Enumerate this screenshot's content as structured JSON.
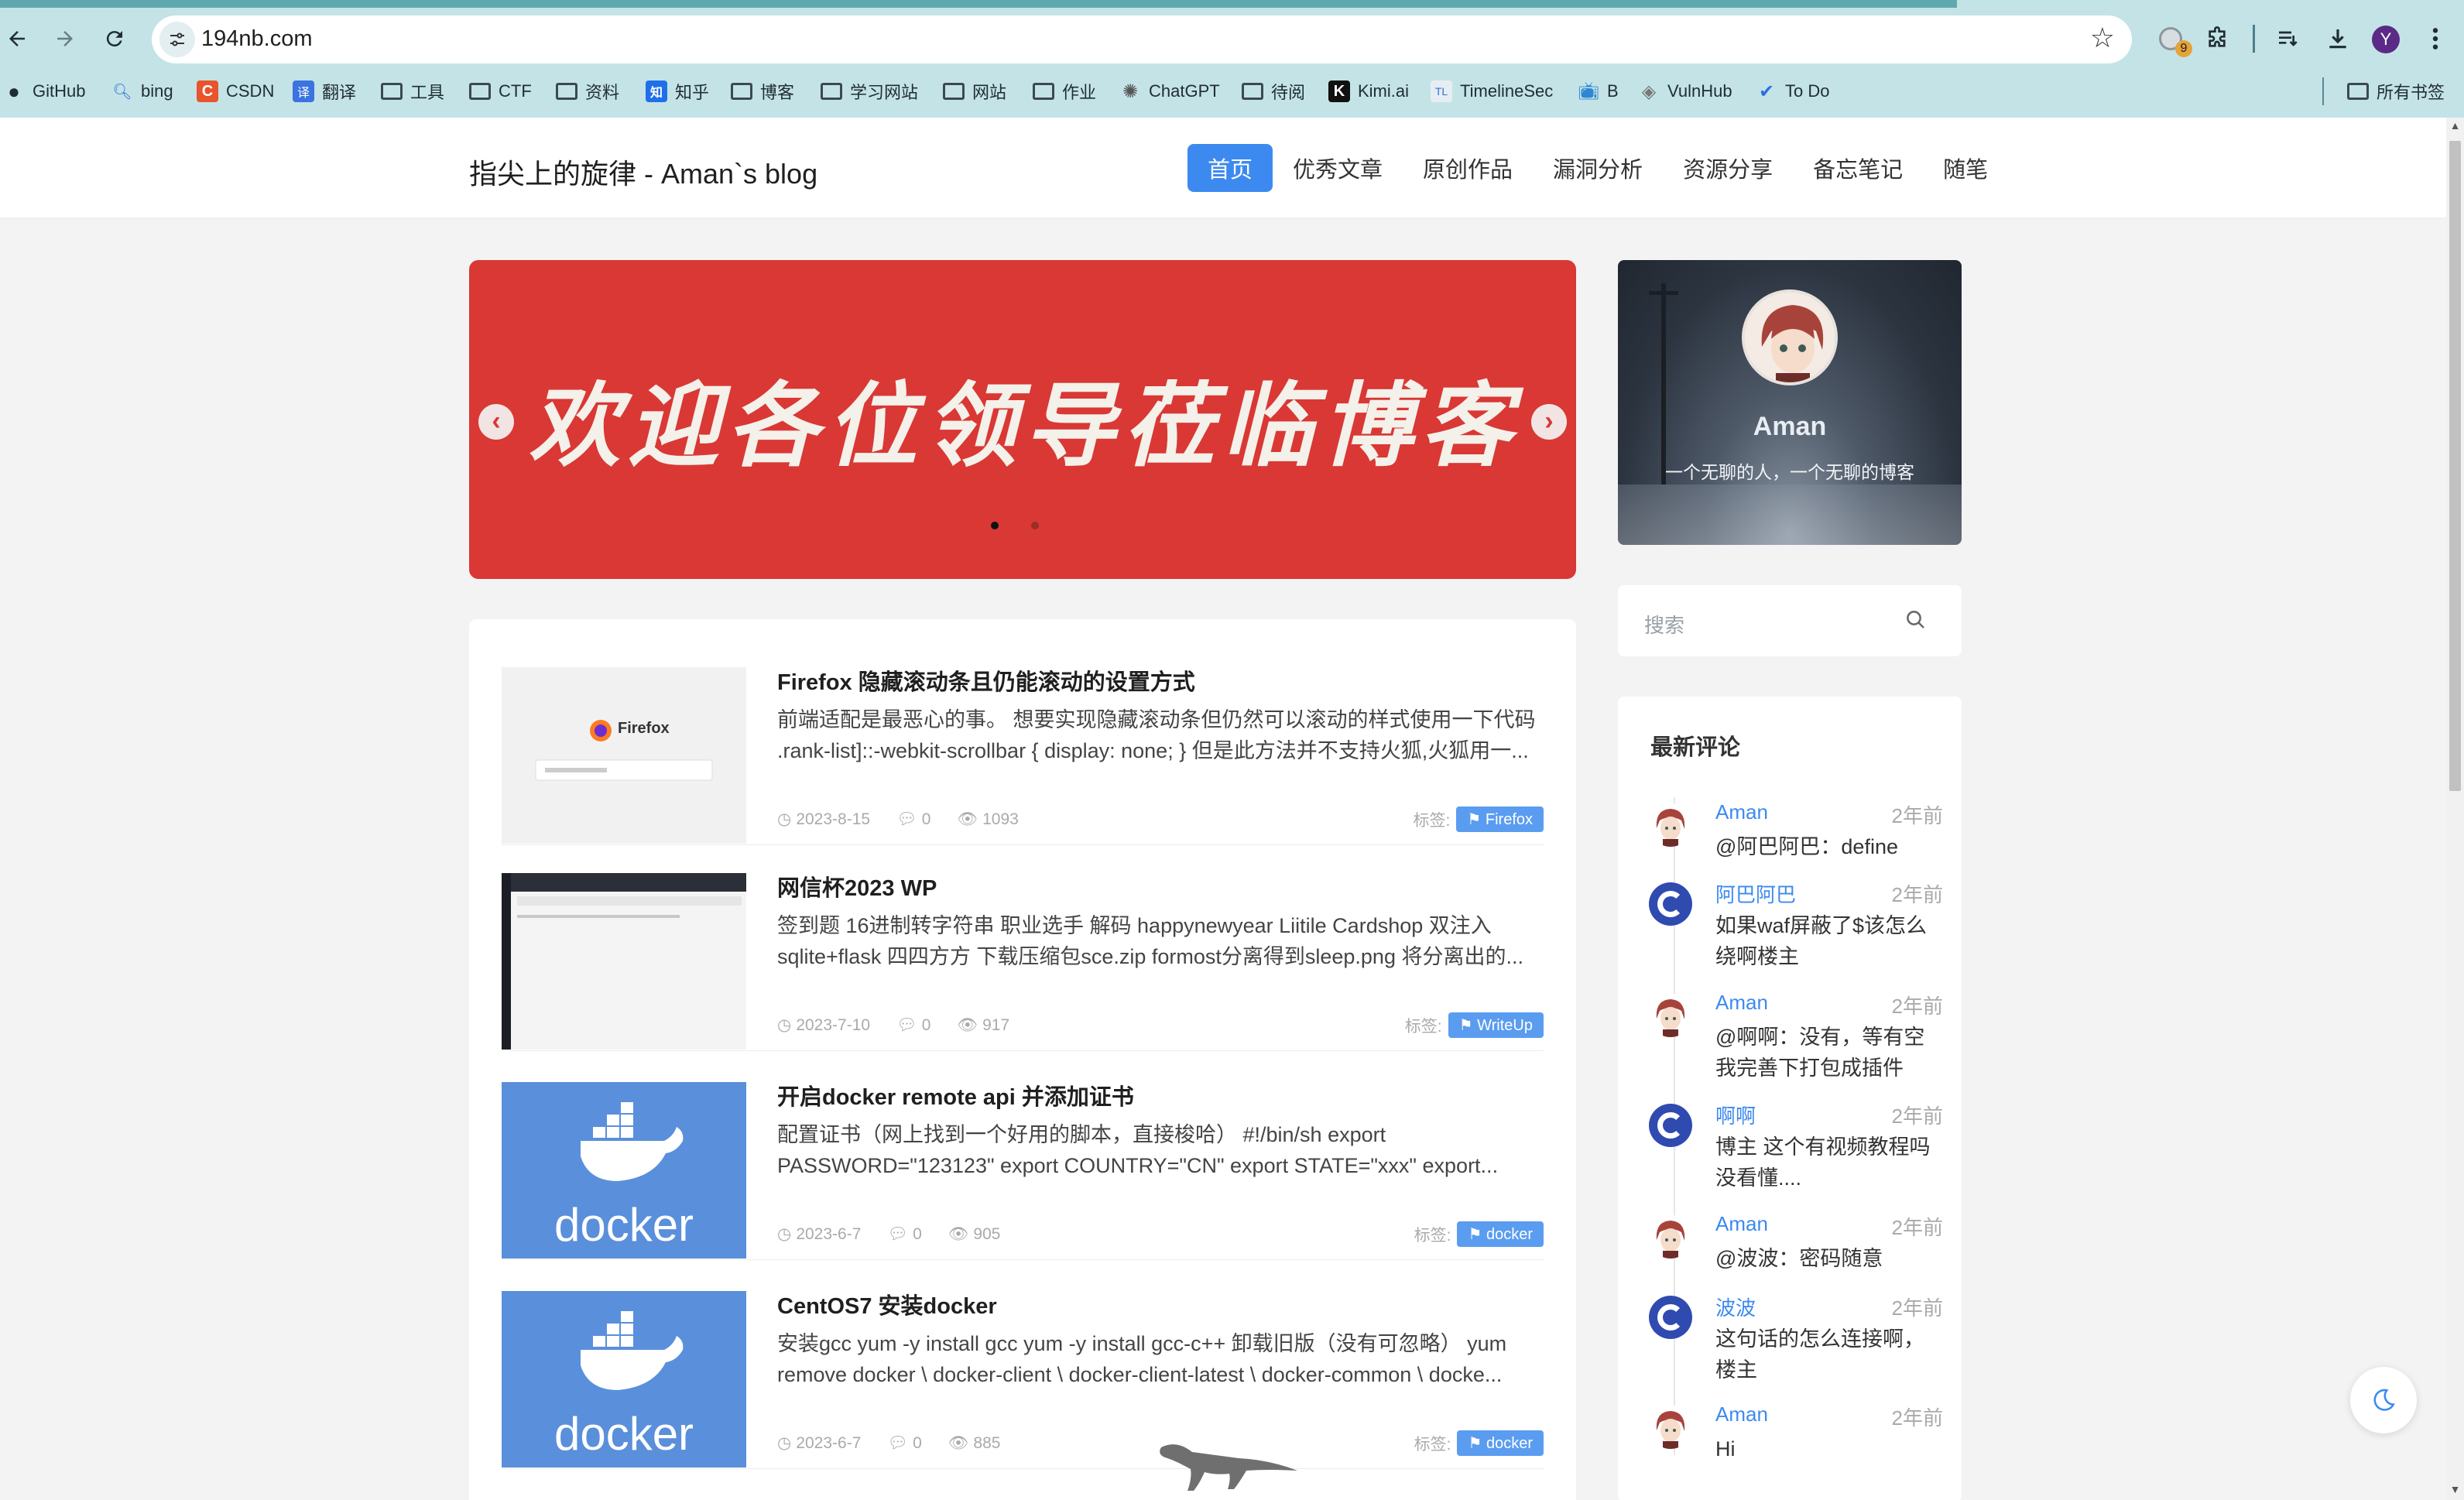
{
  "browser": {
    "url": "194nb.com",
    "extension_badge": "9",
    "profile_initial": "Y",
    "bookmarks": [
      {
        "label": "GitHub",
        "icon": "github-icon"
      },
      {
        "label": "bing",
        "icon": "search-icon"
      },
      {
        "label": "CSDN",
        "icon": "csdn-icon"
      },
      {
        "label": "翻译",
        "icon": "translate-icon"
      },
      {
        "label": "工具",
        "icon": "folder-icon"
      },
      {
        "label": "CTF",
        "icon": "folder-icon"
      },
      {
        "label": "资料",
        "icon": "folder-icon"
      },
      {
        "label": "知乎",
        "icon": "zhihu-icon"
      },
      {
        "label": "博客",
        "icon": "folder-icon"
      },
      {
        "label": "学习网站",
        "icon": "folder-icon"
      },
      {
        "label": "网站",
        "icon": "folder-icon"
      },
      {
        "label": "作业",
        "icon": "folder-icon"
      },
      {
        "label": "ChatGPT",
        "icon": "chatgpt-icon"
      },
      {
        "label": "待阅",
        "icon": "folder-icon"
      },
      {
        "label": "Kimi.ai",
        "icon": "kimi-icon"
      },
      {
        "label": "TimelineSec",
        "icon": "timelinesec-icon"
      },
      {
        "label": "B",
        "icon": "bilibili-icon"
      },
      {
        "label": "VulnHub",
        "icon": "vulnhub-icon"
      },
      {
        "label": "To Do",
        "icon": "todo-icon"
      }
    ],
    "all_bookmarks": "所有书签"
  },
  "site": {
    "logo": "指尖上的旋律 - Aman`s blog",
    "menu": [
      "首页",
      "优秀文章",
      "原创作品",
      "漏洞分析",
      "资源分享",
      "备忘笔记",
      "随笔"
    ],
    "active_menu": 0
  },
  "banner": {
    "text": "欢迎各位领导莅临博客",
    "bg_color": "#d93834"
  },
  "profile": {
    "name": "Aman",
    "description": "一个无聊的人，一个无聊的博客"
  },
  "search": {
    "placeholder": "搜索"
  },
  "comments": {
    "title": "最新评论",
    "items": [
      {
        "user": "Aman",
        "time": "2年前",
        "text": "@阿巴阿巴：define",
        "avatar": "anime-avatar"
      },
      {
        "user": "阿巴阿巴",
        "time": "2年前",
        "text": "如果waf屏蔽了$该怎么绕啊楼主",
        "avatar": "c-logo"
      },
      {
        "user": "Aman",
        "time": "2年前",
        "text": "@啊啊：没有，等有空我完善下打包成插件",
        "avatar": "anime-avatar"
      },
      {
        "user": "啊啊",
        "time": "2年前",
        "text": "博主 这个有视频教程吗 没看懂....",
        "avatar": "c-logo"
      },
      {
        "user": "Aman",
        "time": "2年前",
        "text": "@波波：密码随意",
        "avatar": "anime-avatar"
      },
      {
        "user": "波波",
        "time": "2年前",
        "text": "这句话的怎么连接啊，楼主",
        "avatar": "c-logo"
      },
      {
        "user": "Aman",
        "time": "2年前",
        "text": "Hi",
        "avatar": "anime-avatar"
      }
    ]
  },
  "articles": [
    {
      "title": "Firefox 隐藏滚动条且仍能滚动的设置方式",
      "excerpt_line1": "前端适配是最恶心的事。 想要实现隐藏滚动条但仍然可以滚动的样式使用一下代码",
      "excerpt_line2": ".rank-list]::-webkit-scrollbar { display: none; } 但是此方法并不支持火狐,火狐用一...",
      "date": "2023-8-15",
      "comments": "0",
      "views": "1093",
      "tag_label": "标签:",
      "tag": "Firefox",
      "thumb": "firefox"
    },
    {
      "title": "网信杯2023 WP",
      "excerpt_line1": "签到题 16进制转字符串 职业选手 解码 happynewyear Liitile Cardshop 双注入",
      "excerpt_line2": "sqlite+flask 四四方方 下载压缩包sce.zip formost分离得到sleep.png 将分离出的...",
      "date": "2023-7-10",
      "comments": "0",
      "views": "917",
      "tag_label": "标签:",
      "tag": "WriteUp",
      "thumb": "wp"
    },
    {
      "title": "开启docker remote api 并添加证书",
      "excerpt_line1": "配置证书（网上找到一个好用的脚本，直接梭哈） #!/bin/sh export",
      "excerpt_line2": "PASSWORD=\"123123\" export COUNTRY=\"CN\" export STATE=\"xxx\" export...",
      "date": "2023-6-7",
      "comments": "0",
      "views": "905",
      "tag_label": "标签:",
      "tag": "docker",
      "thumb": "docker"
    },
    {
      "title": "CentOS7 安装docker",
      "excerpt_line1": "安装gcc yum -y install gcc yum -y install gcc-c++ 卸载旧版（没有可忽略） yum",
      "excerpt_line2": "remove docker \\ docker-client \\ docker-client-latest \\ docker-common \\ docke...",
      "date": "2023-6-7",
      "comments": "0",
      "views": "885",
      "tag_label": "标签:",
      "tag": "docker",
      "thumb": "docker"
    }
  ],
  "thumb_texts": {
    "firefox": "Firefox",
    "docker": "docker"
  },
  "colors": {
    "accent": "#3c8af0",
    "chrome_bg": "#c4e3e6",
    "page_bg": "#f3f3f3"
  }
}
